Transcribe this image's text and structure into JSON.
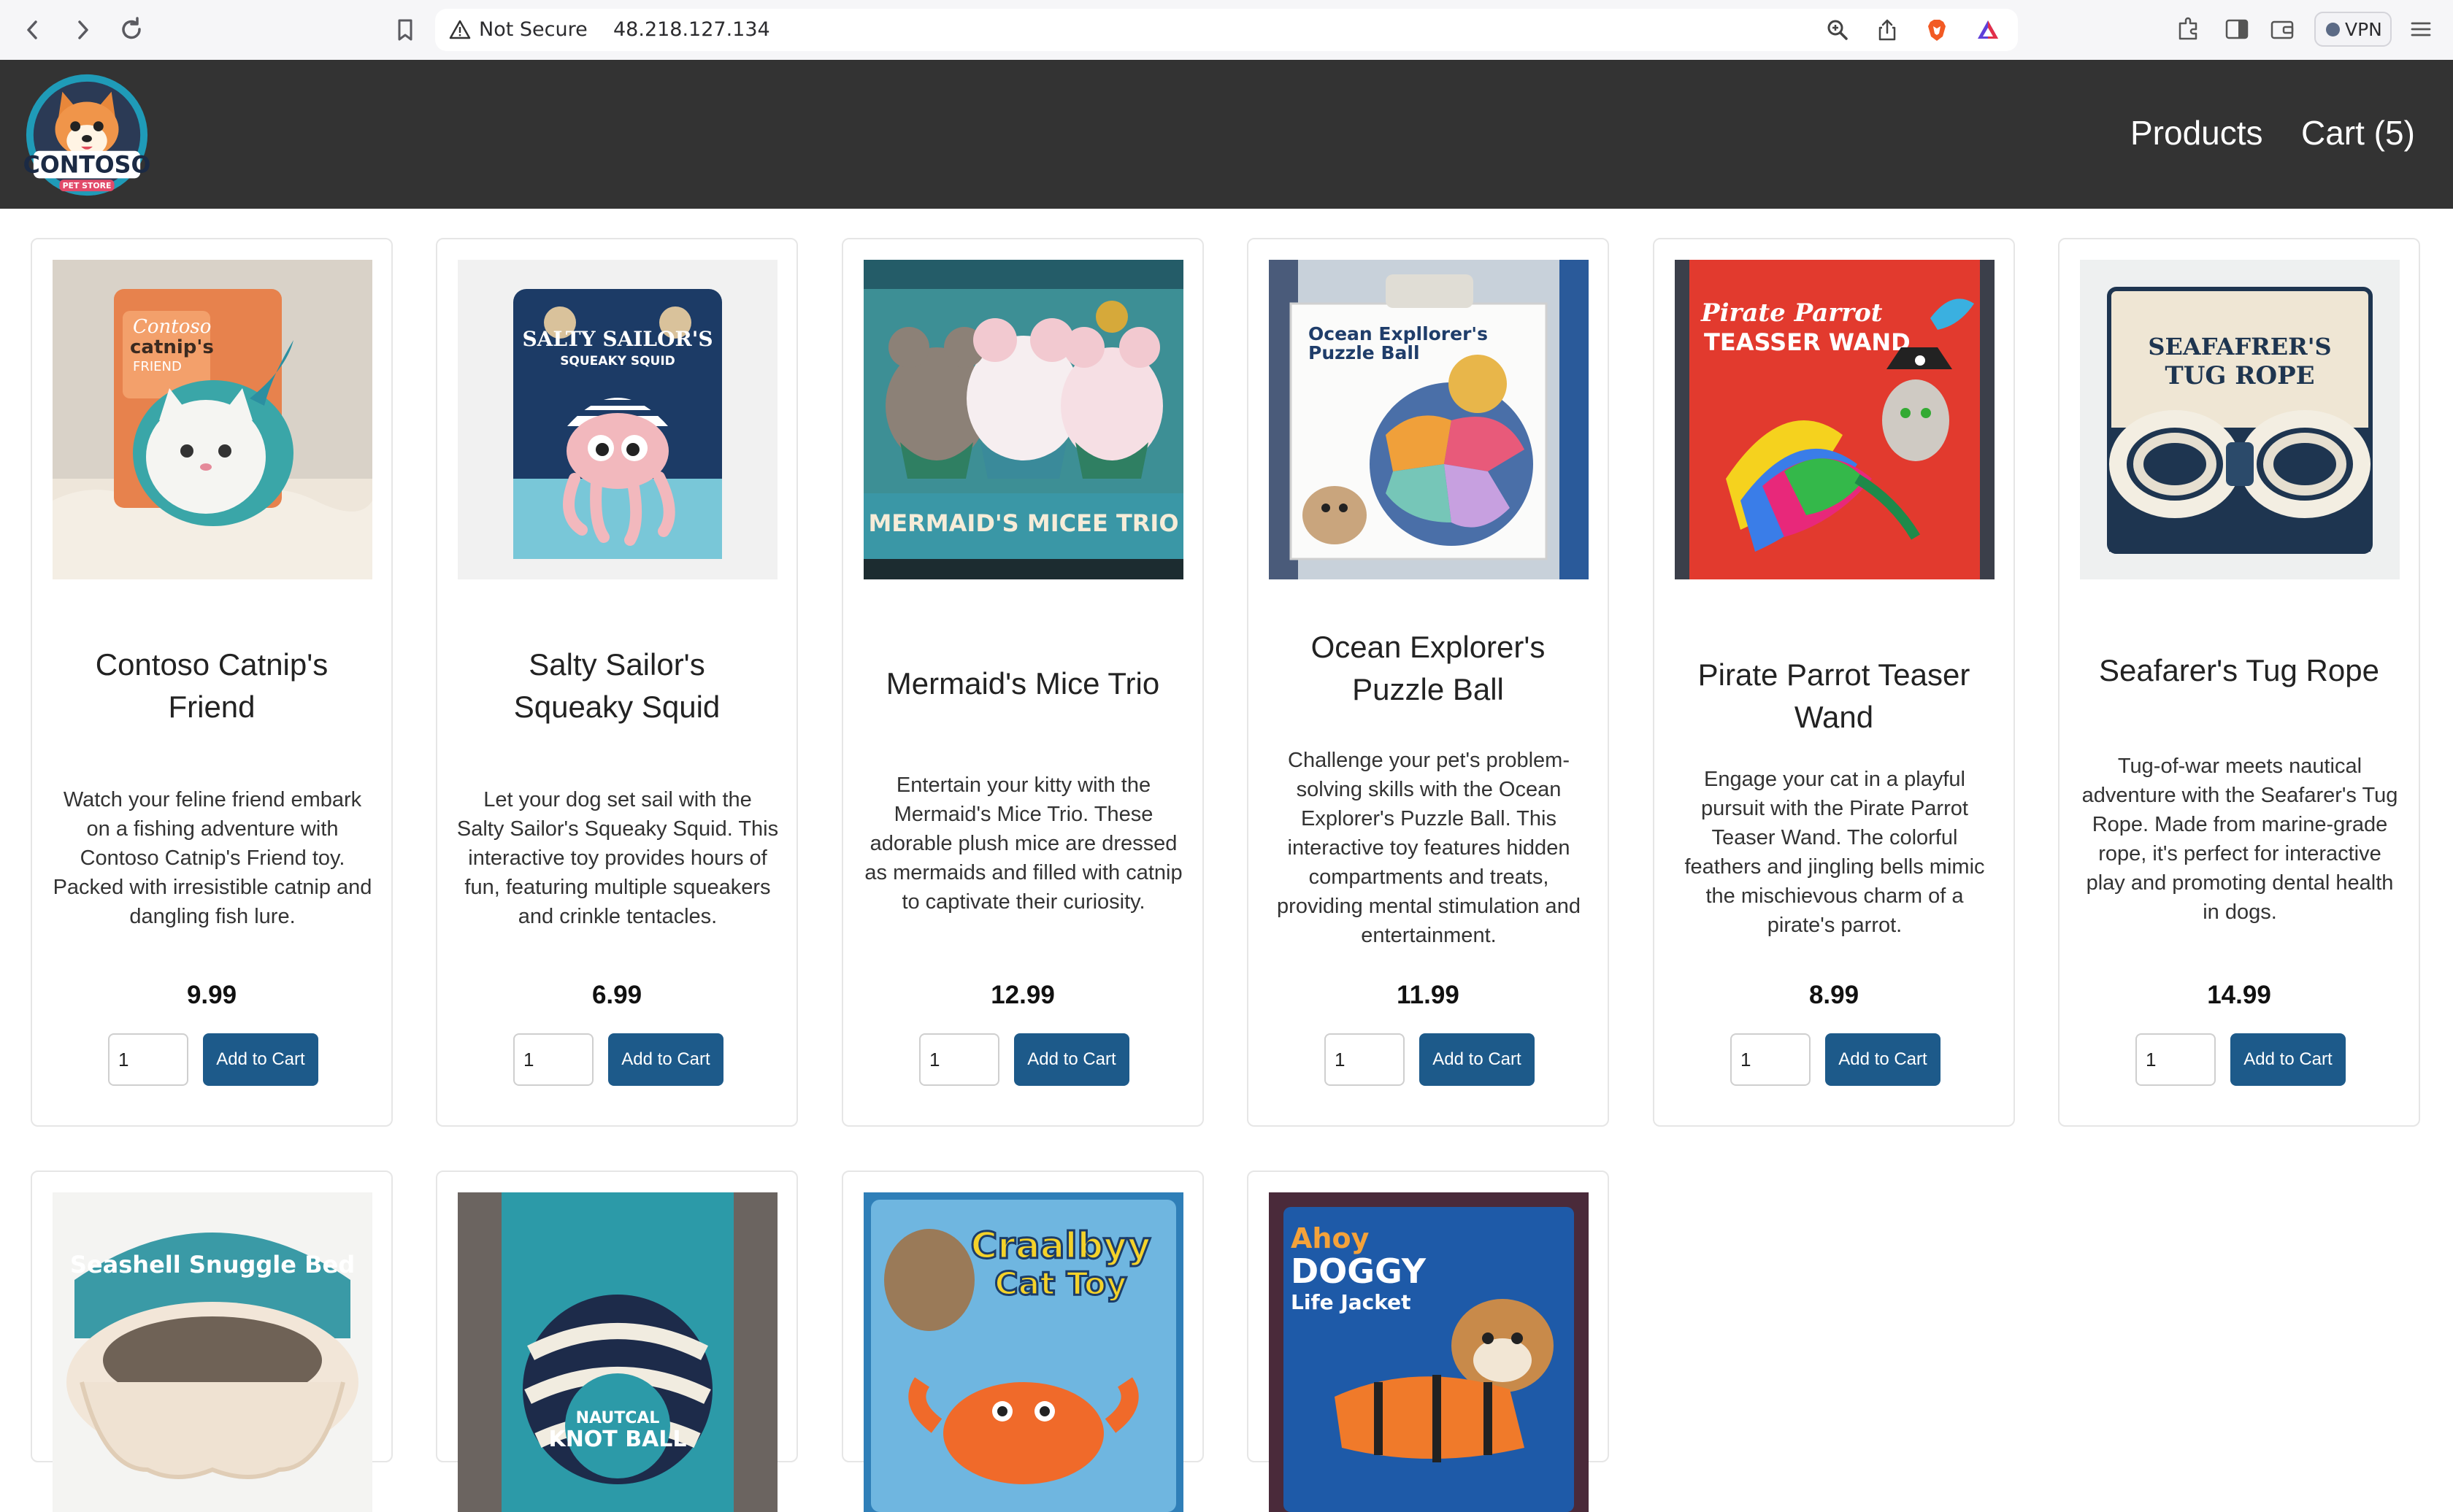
{
  "browser": {
    "security_label": "Not Secure",
    "url": "48.218.127.134",
    "vpn_label": "VPN"
  },
  "header": {
    "logo_text": "CONTOSO",
    "logo_subtext": "PET STORE",
    "nav": [
      {
        "label": "Products"
      },
      {
        "label": "Cart (5)"
      }
    ]
  },
  "add_to_cart_label": "Add to Cart",
  "products": [
    {
      "name_lines": [
        "Contoso Catnip's",
        "Friend"
      ],
      "desc_lines": [
        "Watch your feline friend embark",
        "on a fishing adventure with",
        "Contoso Catnip's Friend toy.",
        "Packed with irresistible catnip and",
        "dangling fish lure."
      ],
      "price": "9.99",
      "qty": "1"
    },
    {
      "name_lines": [
        "Salty Sailor's",
        "Squeaky Squid"
      ],
      "desc_lines": [
        "Let your dog set sail with the",
        "Salty Sailor's Squeaky Squid. This",
        "interactive toy provides hours of",
        "fun, featuring multiple squeakers",
        "and crinkle tentacles."
      ],
      "price": "6.99",
      "qty": "1"
    },
    {
      "name_lines": [
        "Mermaid's Mice Trio"
      ],
      "desc_lines": [
        "Entertain your kitty with the",
        "Mermaid's Mice Trio. These",
        "adorable plush mice are dressed",
        "as mermaids and filled with catnip",
        "to captivate their curiosity."
      ],
      "price": "12.99",
      "qty": "1"
    },
    {
      "name_lines": [
        "Ocean Explorer's",
        "Puzzle Ball"
      ],
      "desc_lines": [
        "Challenge your pet's problem-",
        "solving skills with the Ocean",
        "Explorer's Puzzle Ball. This",
        "interactive toy features hidden",
        "compartments and treats,",
        "providing mental stimulation and",
        "entertainment."
      ],
      "price": "11.99",
      "qty": "1"
    },
    {
      "name_lines": [
        "Pirate Parrot Teaser",
        "Wand"
      ],
      "desc_lines": [
        "Engage your cat in a playful",
        "pursuit with the Pirate Parrot",
        "Teaser Wand. The colorful",
        "feathers and jingling bells mimic",
        "the mischievous charm of a",
        "pirate's parrot."
      ],
      "price": "8.99",
      "qty": "1"
    },
    {
      "name_lines": [
        "Seafarer's Tug Rope"
      ],
      "desc_lines": [
        "Tug-of-war meets nautical",
        "adventure with the Seafarer's Tug",
        "Rope. Made from marine-grade",
        "rope, it's perfect for interactive",
        "play and promoting dental health",
        "in dogs."
      ],
      "price": "14.99",
      "qty": "1"
    }
  ],
  "package_text": {
    "catnip": [
      "Contoso",
      "catnip's",
      "FRIEND"
    ],
    "squid": [
      "SALTY SAILOR'S",
      "SQUEAKY SQUID"
    ],
    "mice": [
      "MERMAID'S MICEE TRIO"
    ],
    "puzzle": [
      "Ocean Expllorer's",
      "Puzzle Ball"
    ],
    "parrot": [
      "Pirate Parrot",
      "TEASSER WAND"
    ],
    "rope": [
      "SEAFAFRER'S",
      "TUG ROPE"
    ],
    "bed": [
      "Seashell Snuggle Bed"
    ],
    "knot": [
      "NAUTCAL",
      "KNOT BALL"
    ],
    "crab": [
      "Craalbyy",
      "Cat Toy"
    ],
    "jacket": [
      "Ahoy",
      "DOGGY",
      "Life Jacket"
    ]
  },
  "colors": {
    "header_bg": "#333333",
    "button_bg": "#1d5a8a"
  }
}
